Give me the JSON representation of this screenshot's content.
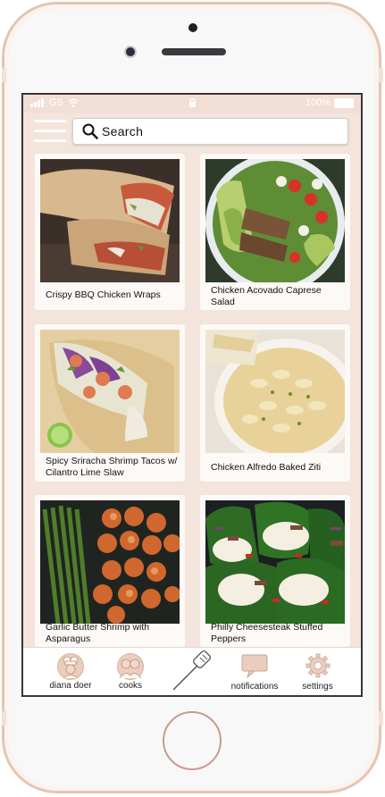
{
  "status_bar": {
    "carrier": "GS",
    "battery": "100%"
  },
  "search": {
    "placeholder": "Search"
  },
  "recipes": [
    {
      "title": "Crispy BBQ Chicken Wraps"
    },
    {
      "title": "Chicken Acovado Caprese Salad"
    },
    {
      "title": "Spicy Sriracha Shrimp Tacos w/ Cilantro Lime Slaw"
    },
    {
      "title": "Chicken Alfredo Baked Ziti"
    },
    {
      "title": "Garlic Butter Shrimp with Asparagus"
    },
    {
      "title": "Philly Cheesesteak Stuffed Peppers"
    }
  ],
  "nav": {
    "profile": "diana doer",
    "cooks": "cooks",
    "notifications": "notifications",
    "settings": "settings"
  },
  "colors": {
    "screen_bg": "#f3e4dc",
    "phone_frame": "#e6c4b3",
    "icon_peach": "#eccdbd"
  }
}
